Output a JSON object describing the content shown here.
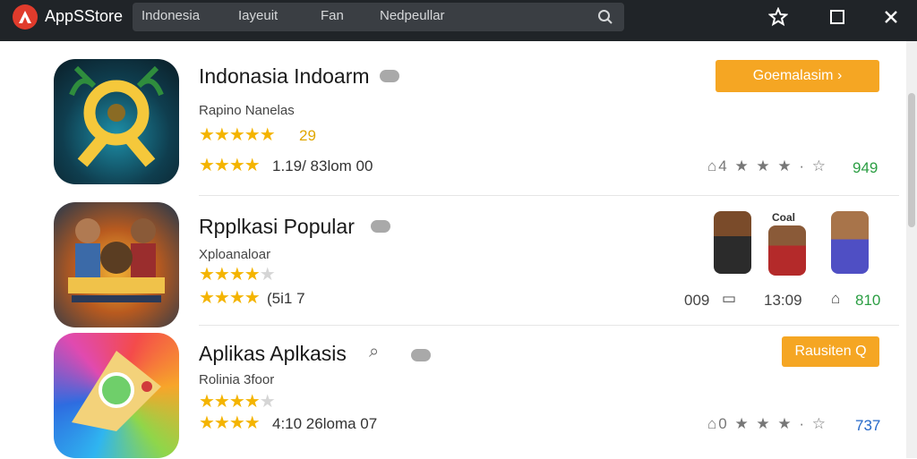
{
  "header": {
    "brand": "AppSStore",
    "search_tabs": [
      "Indonesia",
      "Iayeuit",
      "Fan",
      "Nedpeullar"
    ]
  },
  "apps": [
    {
      "title": "Indonasia Indoarm",
      "developer": "Rapino Nanelas",
      "stars_row1": "★★★★★",
      "rating_count": "29",
      "stars_row2": "★★★★",
      "meta": "1.19/  83lom 00",
      "button": "Goemalasim  ›",
      "stat_right": "949"
    },
    {
      "title": "Rpplkasi Popular",
      "developer": "Xploanaloar",
      "stars_row1": "★★★★",
      "stars_row2": "★★★★",
      "meta": "(5i1 7",
      "stat_left": "009",
      "stat_mid": "13:09",
      "stat_right": "810",
      "avatar_label": "Coal"
    },
    {
      "title": "Aplikas Aplkasis",
      "developer": "Rolinia 3foor",
      "stars_row1": "★★★★",
      "stars_row2": "★★★★",
      "meta": "4:10  26loma 07",
      "button": "Rausiten  Q",
      "stat_right": "737"
    }
  ],
  "colors": {
    "accent": "#f5a623",
    "topbar": "#202428",
    "star": "#f4b400"
  }
}
